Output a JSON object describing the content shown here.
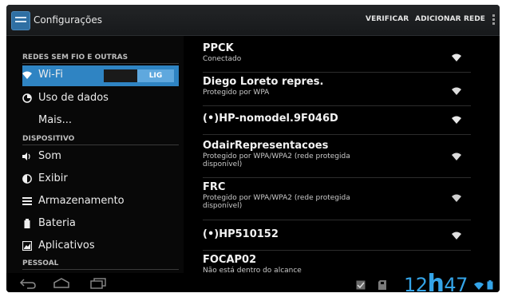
{
  "action_bar": {
    "title": "Configurações",
    "verify": "VERIFICAR",
    "add_network": "ADICIONAR REDE"
  },
  "sidebar": {
    "section_wireless": "REDES SEM FIO E OUTRAS",
    "wifi_label": "Wi-Fi",
    "wifi_toggle": "LIG",
    "data_usage": "Uso de dados",
    "more": "Mais...",
    "section_device": "DISPOSITIVO",
    "sound": "Som",
    "display": "Exibir",
    "storage": "Armazenamento",
    "battery": "Bateria",
    "apps": "Aplicativos",
    "section_personal": "PESSOAL"
  },
  "networks": [
    {
      "name": "PPCK",
      "status": "Conectado"
    },
    {
      "name": "Diego Loreto repres.",
      "status": "Protegido por WPA"
    },
    {
      "name": "(•)HP-nomodel.9F046D",
      "status": ""
    },
    {
      "name": "OdairRepresentacoes",
      "status": "Protegido por WPA/WPA2 (rede protegida disponível)"
    },
    {
      "name": "FRC",
      "status": "Protegido por WPA/WPA2 (rede protegida disponível)"
    },
    {
      "name": "(•)HP510152",
      "status": ""
    },
    {
      "name": "FOCAP02",
      "status": "Não está dentro do alcance"
    }
  ],
  "status_bar": {
    "clock_hour": "12",
    "clock_h": "h",
    "clock_min": "47"
  },
  "colors": {
    "accent": "#2f84c3",
    "clock": "#34a4e8"
  }
}
